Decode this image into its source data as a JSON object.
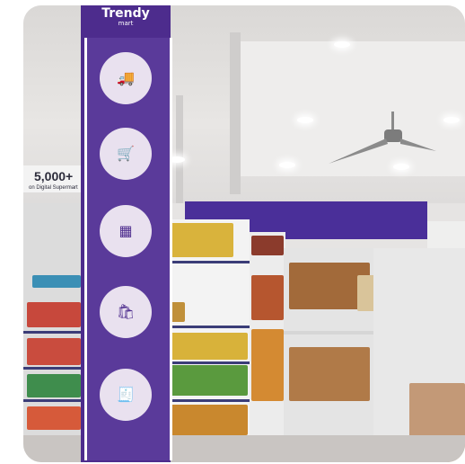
{
  "photo": {
    "description_hidden": false
  },
  "pillar_sign": {
    "logo_main": "Trendy",
    "logo_sub": "mart",
    "icons": [
      {
        "name": "delivery-icon",
        "glyph": "🚚"
      },
      {
        "name": "cart-icon",
        "glyph": "🛒"
      },
      {
        "name": "qr-code-icon",
        "glyph": "▦"
      },
      {
        "name": "basket-icon",
        "glyph": "🛍"
      },
      {
        "name": "checkout-icon",
        "glyph": "🧾"
      }
    ]
  },
  "banner": {
    "headline": "5,000+",
    "subline": "on Digital Supermart"
  },
  "colors": {
    "brand_purple": "#4d2c8d",
    "wall_purple": "#4a2f99"
  }
}
